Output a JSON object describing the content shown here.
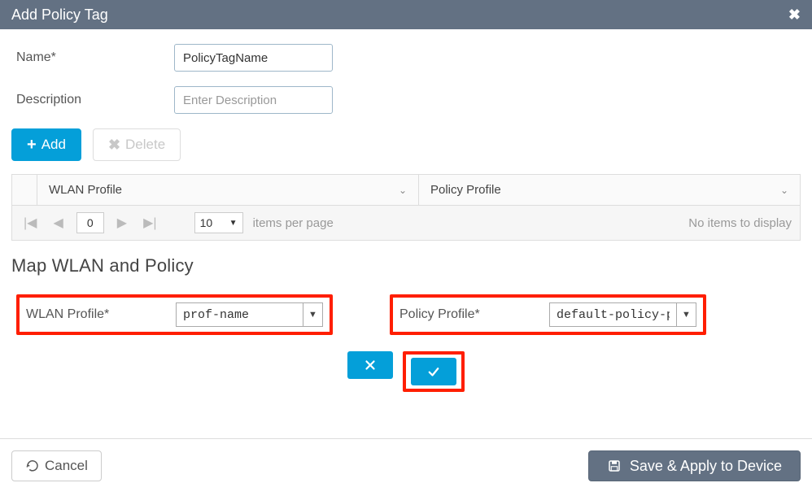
{
  "titlebar": {
    "title": "Add Policy Tag"
  },
  "form": {
    "name_label": "Name*",
    "name_value": "PolicyTagName",
    "desc_label": "Description",
    "desc_placeholder": "Enter Description"
  },
  "actions": {
    "add_label": "Add",
    "delete_label": "Delete"
  },
  "grid": {
    "columns": [
      "WLAN Profile",
      "Policy Profile"
    ],
    "page": "0",
    "per_page": "10",
    "ipp_label": "items per page",
    "empty_text": "No items to display"
  },
  "map_section": {
    "title": "Map WLAN and Policy",
    "wlan_label": "WLAN Profile*",
    "wlan_value": "prof-name",
    "policy_label": "Policy Profile*",
    "policy_value": "default-policy-profile"
  },
  "footer": {
    "cancel_label": "Cancel",
    "save_label": "Save & Apply to Device"
  }
}
